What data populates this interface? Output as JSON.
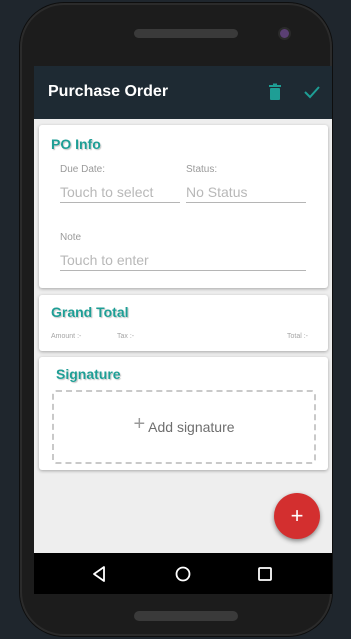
{
  "appbar": {
    "title": "Purchase Order",
    "delete_icon": "trash-icon",
    "confirm_icon": "check-icon",
    "background": "#1e2a33",
    "accent": "#1e9e95"
  },
  "po_info": {
    "title": "PO Info",
    "due_date_label": "Due Date:",
    "due_date_placeholder": "Touch to select",
    "status_label": "Status:",
    "status_value": "No Status",
    "note_label": "Note",
    "note_placeholder": "Touch to enter"
  },
  "grand_total": {
    "title": "Grand Total",
    "amount_label": "Amount :-",
    "tax_label": "Tax :-",
    "total_label": "Total :-"
  },
  "signature": {
    "title": "Signature",
    "add_label": "Add signature"
  },
  "fab": {
    "label": "+",
    "color": "#d32f2f"
  },
  "navbar": {
    "back_icon": "back-triangle-icon",
    "home_icon": "home-circle-icon",
    "recents_icon": "recents-square-icon"
  }
}
